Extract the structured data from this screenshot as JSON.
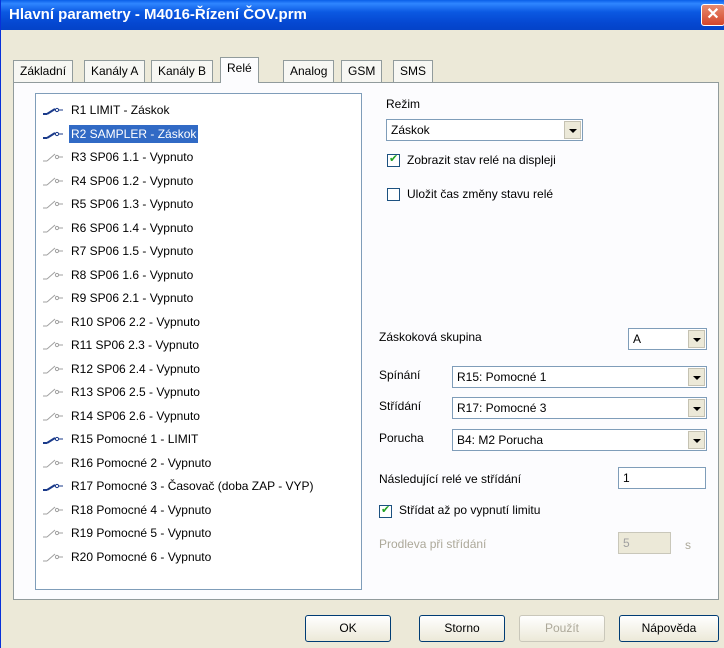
{
  "window": {
    "title": "Hlavní parametry - M4016-Řízení ČOV.prm",
    "close_glyph": "✕"
  },
  "tabs": [
    "Základní",
    "Kanály A",
    "Kanály B",
    "Relé",
    "Analog",
    "GSM",
    "SMS"
  ],
  "active_tab": "Relé",
  "relays": [
    {
      "label": "R1 LIMIT - Záskok",
      "state": "on"
    },
    {
      "label": "R2 SAMPLER - Záskok",
      "state": "on",
      "selected": true
    },
    {
      "label": "R3 SP06 1.1 - Vypnuto",
      "state": "off"
    },
    {
      "label": "R4 SP06 1.2 - Vypnuto",
      "state": "off"
    },
    {
      "label": "R5 SP06 1.3 - Vypnuto",
      "state": "off"
    },
    {
      "label": "R6 SP06 1.4 - Vypnuto",
      "state": "off"
    },
    {
      "label": "R7 SP06 1.5 - Vypnuto",
      "state": "off"
    },
    {
      "label": "R8 SP06 1.6 - Vypnuto",
      "state": "off"
    },
    {
      "label": "R9 SP06 2.1 - Vypnuto",
      "state": "off"
    },
    {
      "label": "R10 SP06 2.2 - Vypnuto",
      "state": "off"
    },
    {
      "label": "R11 SP06 2.3 - Vypnuto",
      "state": "off"
    },
    {
      "label": "R12 SP06 2.4 - Vypnuto",
      "state": "off"
    },
    {
      "label": "R13 SP06 2.5 - Vypnuto",
      "state": "off"
    },
    {
      "label": "R14 SP06 2.6 - Vypnuto",
      "state": "off"
    },
    {
      "label": "R15 Pomocné 1 - LIMIT",
      "state": "on"
    },
    {
      "label": "R16 Pomocné 2 - Vypnuto",
      "state": "off"
    },
    {
      "label": "R17 Pomocné 3 - Časovač (doba ZAP - VYP)",
      "state": "on"
    },
    {
      "label": "R18 Pomocné 4 - Vypnuto",
      "state": "off"
    },
    {
      "label": "R19 Pomocné 5 - Vypnuto",
      "state": "off"
    },
    {
      "label": "R20 Pomocné 6 - Vypnuto",
      "state": "off"
    }
  ],
  "relay_icon_colors": {
    "on": "#1a3a8a",
    "off": "#a0a0a0"
  },
  "settings": {
    "mode_label": "Režim",
    "mode_value": "Záskok",
    "show_on_display_label": "Zobrazit stav relé na displeji",
    "show_on_display_checked": true,
    "save_time_label": "Uložit čas změny stavu relé",
    "save_time_checked": false,
    "backup_group_label": "Záskoková skupina",
    "backup_group_value": "A",
    "switching_label": "Spínání",
    "switching_value": "R15: Pomocné 1",
    "alternating_label": "Střídání",
    "alternating_value": "R17: Pomocné 3",
    "fault_label": "Porucha",
    "fault_value": "B4: M2 Porucha",
    "next_relay_label": "Následující relé ve střídání",
    "next_relay_value": "1",
    "alternate_after_limit_label": "Střídat až po vypnutí limitu",
    "alternate_after_limit_checked": true,
    "delay_label": "Prodleva při střídání",
    "delay_value": "5",
    "delay_unit": "s"
  },
  "buttons": {
    "ok": "OK",
    "cancel": "Storno",
    "apply": "Použít",
    "help": "Nápověda"
  }
}
